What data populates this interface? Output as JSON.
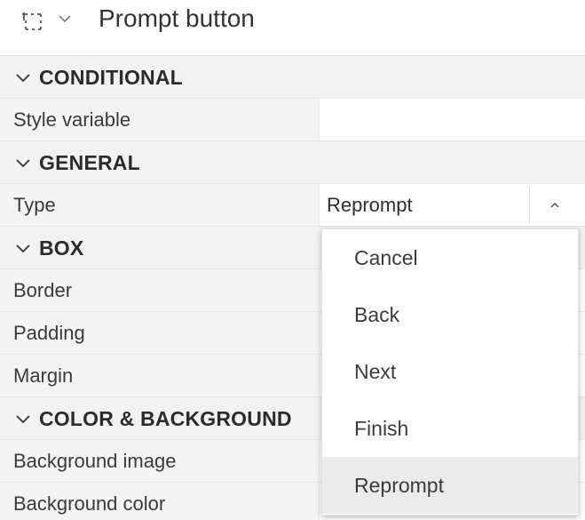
{
  "header": {
    "title": "Prompt button",
    "object_icon": "dashed-selection-icon",
    "menu_icon": "chevron-down-icon"
  },
  "sections": {
    "conditional": {
      "label": "CONDITIONAL",
      "expanded": true
    },
    "general": {
      "label": "GENERAL",
      "expanded": true
    },
    "box": {
      "label": "BOX",
      "expanded": true
    },
    "color_background": {
      "label": "COLOR & BACKGROUND",
      "expanded": true
    }
  },
  "properties": {
    "style_variable": {
      "label": "Style variable",
      "value": ""
    },
    "type": {
      "label": "Type",
      "value": "Reprompt"
    },
    "border": {
      "label": "Border",
      "value": ""
    },
    "padding": {
      "label": "Padding",
      "value": ""
    },
    "margin": {
      "label": "Margin",
      "value": ""
    },
    "background_image": {
      "label": "Background image",
      "value": ""
    },
    "background_color": {
      "label": "Background color",
      "value": ""
    }
  },
  "type_dropdown": {
    "open": true,
    "options": [
      "Cancel",
      "Back",
      "Next",
      "Finish",
      "Reprompt"
    ],
    "selected": "Reprompt"
  }
}
